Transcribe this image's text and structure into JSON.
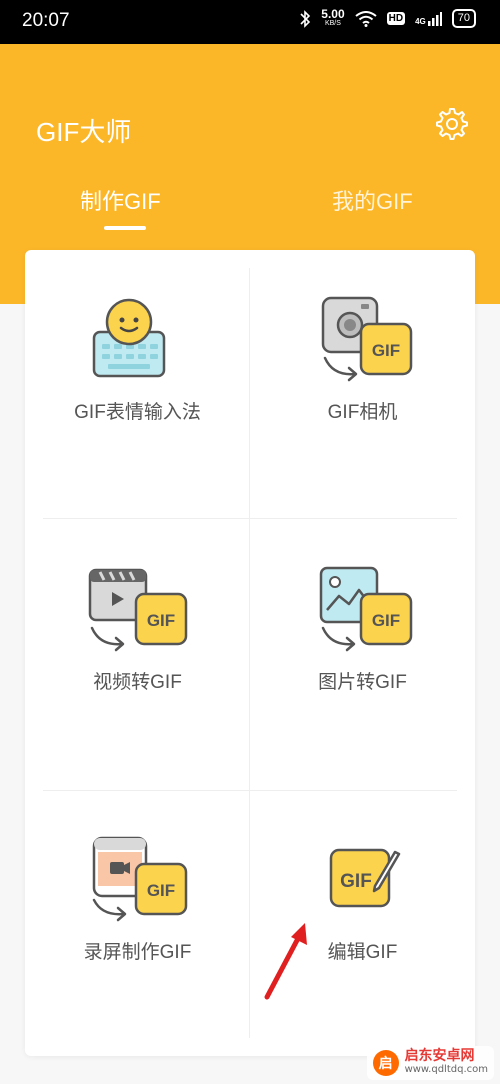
{
  "status_bar": {
    "time": "20:07",
    "net_speed_value": "5.00",
    "net_speed_unit": "KB/S",
    "hd": "HD",
    "signal": "4G",
    "battery": "70",
    "icons": [
      "bluetooth-icon",
      "wifi-icon",
      "signal-icon",
      "battery-icon"
    ]
  },
  "app": {
    "title": "GIF大师",
    "settings_icon": "gear-icon",
    "accent_color": "#fcb729"
  },
  "tabs": [
    {
      "label": "制作GIF",
      "active": true
    },
    {
      "label": "我的GIF",
      "active": false
    }
  ],
  "features": [
    {
      "label": "GIF表情输入法",
      "icon": "emoji-keyboard-icon"
    },
    {
      "label": "GIF相机",
      "icon": "camera-gif-icon"
    },
    {
      "label": "视频转GIF",
      "icon": "video-to-gif-icon"
    },
    {
      "label": "图片转GIF",
      "icon": "image-to-gif-icon"
    },
    {
      "label": "录屏制作GIF",
      "icon": "screen-record-gif-icon"
    },
    {
      "label": "编辑GIF",
      "icon": "edit-gif-icon"
    }
  ],
  "gif_badge": "GIF",
  "watermark": {
    "logo": "启",
    "title": "启东安卓网",
    "url": "www.qdltdq.com"
  }
}
